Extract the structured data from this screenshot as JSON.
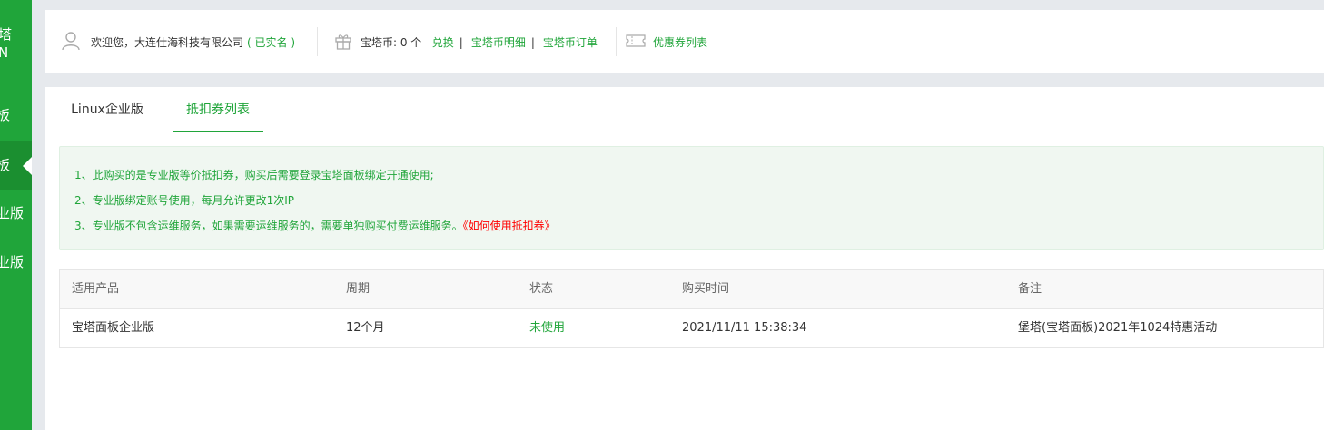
{
  "sidebar": {
    "logo_line1": "塔",
    "logo_line2": "N",
    "items": [
      {
        "label": "板"
      },
      {
        "label": "板"
      },
      {
        "label": "业版"
      },
      {
        "label": "业版"
      }
    ]
  },
  "topbar": {
    "welcome": "欢迎您，大连仕海科技有限公司",
    "verified": "( 已实名 )",
    "coins_label": "宝塔币: 0 个",
    "exchange": "兑换",
    "coin_detail": "宝塔币明细",
    "coin_orders": "宝塔币订单",
    "coupon_list": "优惠券列表",
    "separator": "|"
  },
  "tabs": [
    {
      "label": "Linux企业版"
    },
    {
      "label": "抵扣券列表"
    }
  ],
  "notice": {
    "line1": "1、此购买的是专业版等价抵扣券，购买后需要登录宝塔面板绑定开通使用;",
    "line2": "2、专业版绑定账号使用，每月允许更改1次IP",
    "line3": "3、专业版不包含运维服务，如果需要运维服务的，需要单独购买付费运维服务。",
    "link": "《如何使用抵扣券》"
  },
  "table": {
    "headers": [
      "适用产品",
      "周期",
      "状态",
      "购买时间",
      "备注"
    ],
    "rows": [
      [
        "宝塔面板企业版",
        "12个月",
        "未使用",
        "2021/11/11 15:38:34",
        "堡塔(宝塔面板)2021年1024特惠活动"
      ]
    ]
  },
  "colors": {
    "accent": "#20a53a",
    "link_red": "#ff0000"
  }
}
